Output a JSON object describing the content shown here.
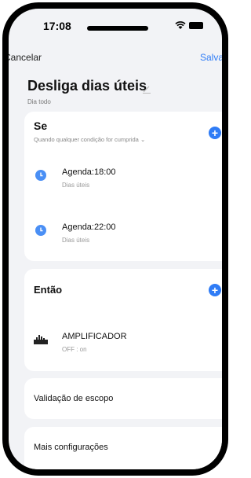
{
  "status": {
    "time": "17:08"
  },
  "nav": {
    "cancel": "Cancelar",
    "save": "Salvar"
  },
  "header": {
    "title": "Desliga dias úteis",
    "subtitle": "Dia todo"
  },
  "if_section": {
    "title": "Se",
    "condition": "Quando qualquer condição for cumprida",
    "items": [
      {
        "label": "Agenda:18:00",
        "sub": "Dias úteis"
      },
      {
        "label": "Agenda:22:00",
        "sub": "Dias úteis"
      }
    ]
  },
  "then_section": {
    "title": "Então",
    "items": [
      {
        "label": "AMPLIFICADOR",
        "sub": "OFF : on"
      }
    ]
  },
  "scope": {
    "label": "Validação de escopo"
  },
  "more": {
    "label": "Mais configurações"
  },
  "colors": {
    "accent": "#2f7cf6",
    "background": "#f2f3f6"
  }
}
